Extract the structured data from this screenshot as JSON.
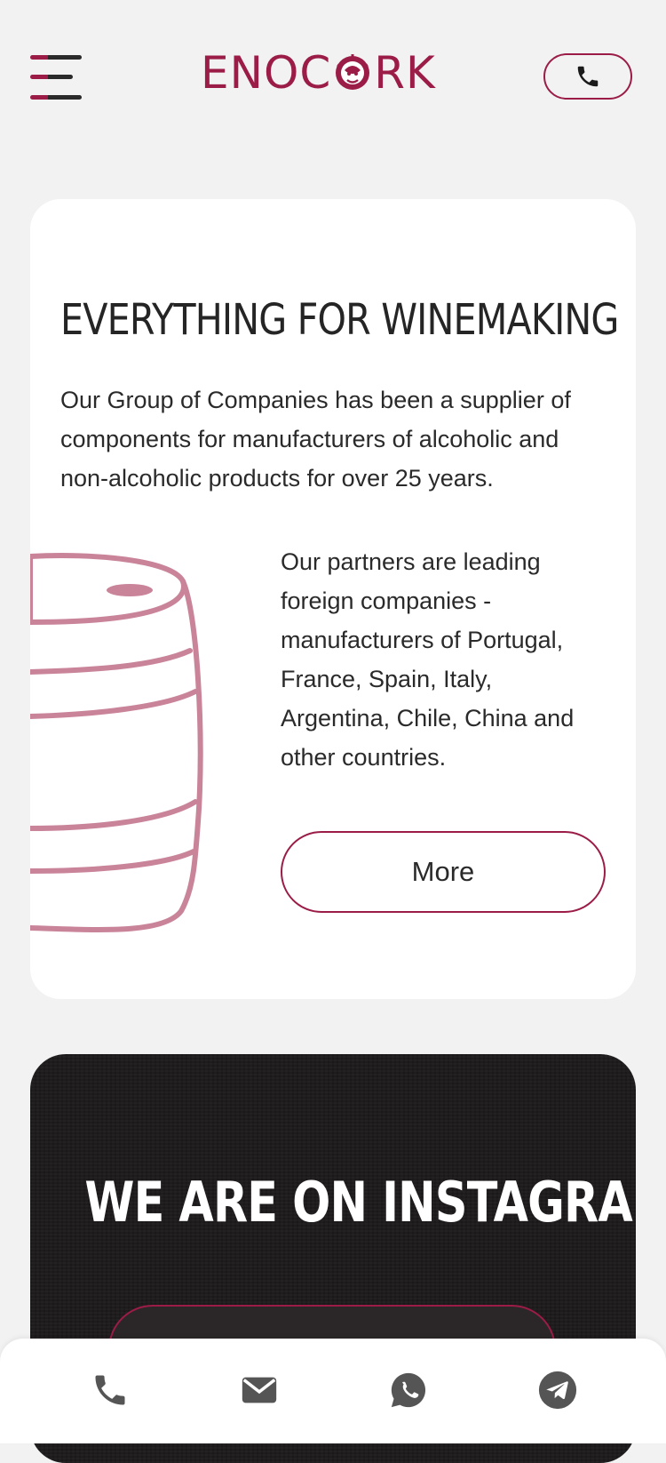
{
  "header": {
    "logo_left": "ENOC",
    "logo_right": "RK",
    "menu_icon": "hamburger-icon",
    "call_icon": "phone-icon"
  },
  "intro_card": {
    "title": "EVERYTHING FOR WINEMAKING",
    "intro": "Our Group of Companies has been a supplier of components for manufacturers of alcoholic and non-alcoholic products for over 25 years.",
    "partners": "Our partners are leading foreign companies - manufacturers of Portugal, France, Spain, Italy, Argentina, Chile, China and other countries.",
    "more_label": "More",
    "illustration": "barrel-icon"
  },
  "instagram_card": {
    "title": "WE ARE ON INSTAGRAM"
  },
  "bottom_bar": {
    "items": [
      {
        "icon": "phone-icon"
      },
      {
        "icon": "mail-icon"
      },
      {
        "icon": "whatsapp-icon"
      },
      {
        "icon": "telegram-icon"
      }
    ]
  },
  "colors": {
    "brand": "#9a1c47",
    "barrel": "#c9849a",
    "background": "#f2f2f2",
    "dark_card": "#1f1c1d",
    "text": "#2a2a2a",
    "bottom_icons": "#555555"
  }
}
